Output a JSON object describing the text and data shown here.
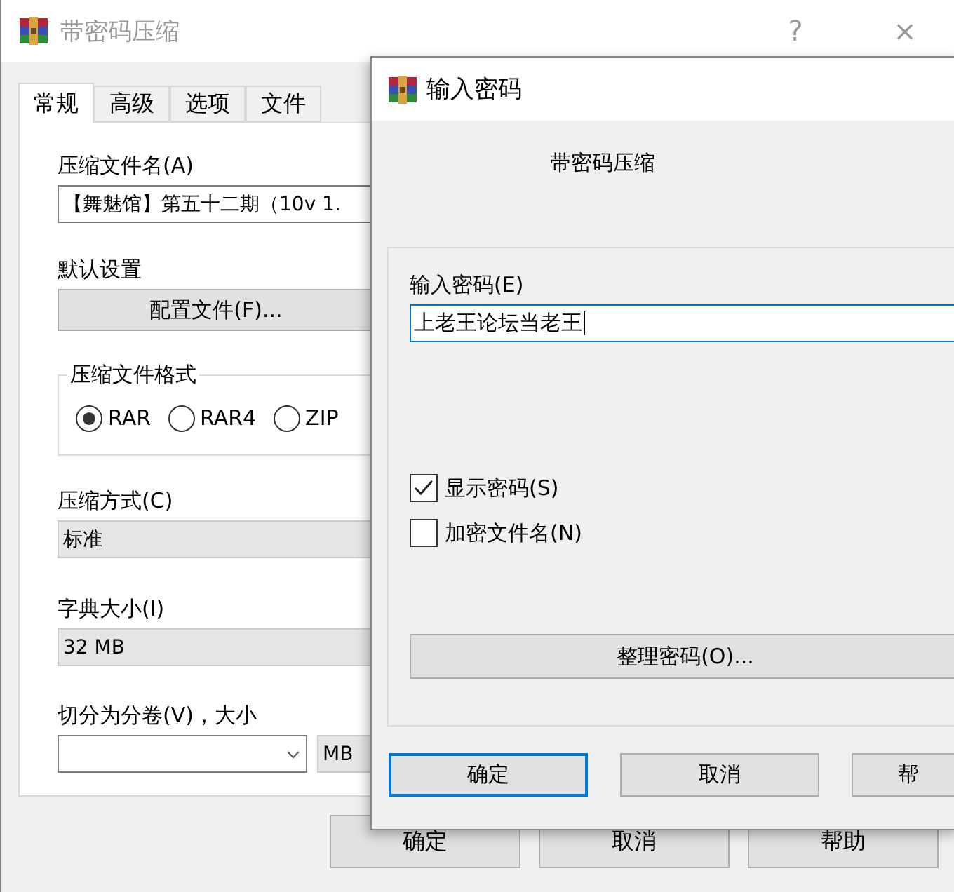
{
  "back_window": {
    "title": "带密码压缩",
    "help_glyph": "?",
    "close_glyph": "×",
    "tabs": [
      {
        "label": "常规",
        "selected": true
      },
      {
        "label": "高级",
        "selected": false
      },
      {
        "label": "选项",
        "selected": false
      },
      {
        "label": "文件",
        "selected": false
      }
    ],
    "archive_name": {
      "label": "压缩文件名(A)",
      "value": "【舞魅馆】第五十二期（10v 1."
    },
    "default_settings": {
      "label": "默认设置",
      "button": "配置文件(F)..."
    },
    "format": {
      "label": "压缩文件格式",
      "options": [
        {
          "label": "RAR",
          "selected": true
        },
        {
          "label": "RAR4",
          "selected": false
        },
        {
          "label": "ZIP",
          "selected": false
        }
      ]
    },
    "method": {
      "label": "压缩方式(C)",
      "value": "标准"
    },
    "dictionary": {
      "label": "字典大小(I)",
      "value": "32 MB"
    },
    "split": {
      "label": "切分为分卷(V)，大小",
      "unit": "MB"
    },
    "buttons": [
      "确定",
      "取消",
      "帮助"
    ]
  },
  "dialog": {
    "title": "输入密码",
    "subtitle": "带密码压缩",
    "password": {
      "label": "输入密码(E)",
      "value": "上老王论坛当老王"
    },
    "options": [
      {
        "label": "显示密码(S)",
        "checked": true
      },
      {
        "label": "加密文件名(N)",
        "checked": false
      }
    ],
    "organize_button": "整理密码(O)...",
    "buttons": [
      {
        "label": "确定",
        "default": true
      },
      {
        "label": "取消",
        "default": false
      },
      {
        "label": "帮",
        "default": false
      }
    ]
  }
}
